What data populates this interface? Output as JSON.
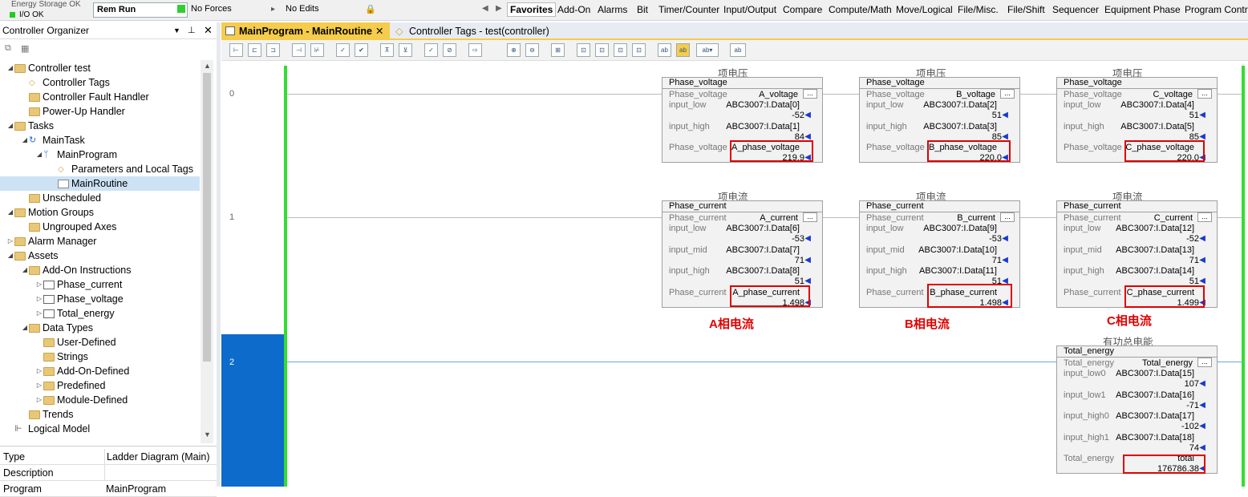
{
  "top": {
    "status1": "Energy Storage OK",
    "status2": "I/O OK",
    "mode": "Rem Run",
    "forces": "No Forces",
    "edits": "No Edits",
    "tabs": [
      "Favorites",
      "Add-On",
      "Alarms",
      "Bit",
      "Timer/Counter",
      "Input/Output",
      "Compare",
      "Compute/Math",
      "Move/Logical",
      "File/Misc.",
      "File/Shift",
      "Sequencer",
      "Equipment Phase",
      "Program Control"
    ]
  },
  "organizer": {
    "title": "Controller Organizer",
    "tree": [
      {
        "label": "Controller test"
      },
      {
        "label": "Controller Tags"
      },
      {
        "label": "Controller Fault Handler"
      },
      {
        "label": "Power-Up Handler"
      },
      {
        "label": "Tasks"
      },
      {
        "label": "MainTask"
      },
      {
        "label": "MainProgram"
      },
      {
        "label": "Parameters and Local Tags"
      },
      {
        "label": "MainRoutine"
      },
      {
        "label": "Unscheduled"
      },
      {
        "label": "Motion Groups"
      },
      {
        "label": "Ungrouped Axes"
      },
      {
        "label": "Alarm Manager"
      },
      {
        "label": "Assets"
      },
      {
        "label": "Add-On Instructions"
      },
      {
        "label": "Phase_current"
      },
      {
        "label": "Phase_voltage"
      },
      {
        "label": "Total_energy"
      },
      {
        "label": "Data Types"
      },
      {
        "label": "User-Defined"
      },
      {
        "label": "Strings"
      },
      {
        "label": "Add-On-Defined"
      },
      {
        "label": "Predefined"
      },
      {
        "label": "Module-Defined"
      },
      {
        "label": "Trends"
      },
      {
        "label": "Logical Model"
      }
    ],
    "props": [
      {
        "k": "Type",
        "v": "Ladder Diagram (Main)"
      },
      {
        "k": "Description",
        "v": ""
      },
      {
        "k": "Program",
        "v": "MainProgram"
      }
    ]
  },
  "editor": {
    "tab1": "MainProgram - MainRoutine",
    "tab2": "Controller Tags - test(controller)",
    "rungs": [
      "0",
      "1",
      "2"
    ],
    "caption_v": "项电压",
    "caption_i": "项电流",
    "caption_e": "有功总电能",
    "red_a": "A相电流",
    "red_b": "B相电流",
    "red_c": "C相电流",
    "blocks": {
      "va": {
        "name": "Phase_voltage",
        "inst": "A_voltage",
        "r1l": "input_low",
        "r1t": "ABC3007:I.Data[0]",
        "r1v": "-52",
        "r2l": "input_high",
        "r2t": "ABC3007:I.Data[1]",
        "r2v": "84",
        "ol": "Phase_voltage",
        "ot": "A_phase_voltage",
        "ov": "219.9"
      },
      "vb": {
        "name": "Phase_voltage",
        "inst": "B_voltage",
        "r1l": "input_low",
        "r1t": "ABC3007:I.Data[2]",
        "r1v": "51",
        "r2l": "input_high",
        "r2t": "ABC3007:I.Data[3]",
        "r2v": "85",
        "ol": "Phase_voltage",
        "ot": "B_phase_voltage",
        "ov": "220.0"
      },
      "vc": {
        "name": "Phase_voltage",
        "inst": "C_voltage",
        "r1l": "input_low",
        "r1t": "ABC3007:I.Data[4]",
        "r1v": "51",
        "r2l": "input_high",
        "r2t": "ABC3007:I.Data[5]",
        "r2v": "85",
        "ol": "Phase_voltage",
        "ot": "C_phase_voltage",
        "ov": "220.0"
      },
      "ia": {
        "name": "Phase_current",
        "inst": "A_current",
        "r1l": "input_low",
        "r1t": "ABC3007:I.Data[6]",
        "r1v": "-53",
        "r2l": "input_mid",
        "r2t": "ABC3007:I.Data[7]",
        "r2v": "71",
        "r3l": "input_high",
        "r3t": "ABC3007:I.Data[8]",
        "r3v": "51",
        "ol": "Phase_current",
        "ot": "A_phase_current",
        "ov": "1.498"
      },
      "ib": {
        "name": "Phase_current",
        "inst": "B_current",
        "r1l": "input_low",
        "r1t": "ABC3007:I.Data[9]",
        "r1v": "-53",
        "r2l": "input_mid",
        "r2t": "ABC3007:I.Data[10]",
        "r2v": "71",
        "r3l": "input_high",
        "r3t": "ABC3007:I.Data[11]",
        "r3v": "51",
        "ol": "Phase_current",
        "ot": "B_phase_current",
        "ov": "1.498"
      },
      "ic": {
        "name": "Phase_current",
        "inst": "C_current",
        "r1l": "input_low",
        "r1t": "ABC3007:I.Data[12]",
        "r1v": "-52",
        "r2l": "input_mid",
        "r2t": "ABC3007:I.Data[13]",
        "r2v": "71",
        "r3l": "input_high",
        "r3t": "ABC3007:I.Data[14]",
        "r3v": "51",
        "ol": "Phase_current",
        "ot": "C_phase_current",
        "ov": "1.499"
      },
      "te": {
        "name": "Total_energy",
        "inst": "Total_energy",
        "r1l": "input_low0",
        "r1t": "ABC3007:I.Data[15]",
        "r1v": "107",
        "r2l": "input_low1",
        "r2t": "ABC3007:I.Data[16]",
        "r2v": "-71",
        "r3l": "input_high0",
        "r3t": "ABC3007:I.Data[17]",
        "r3v": "-102",
        "r4l": "input_high1",
        "r4t": "ABC3007:I.Data[18]",
        "r4v": "74",
        "ol": "Total_energy",
        "ot": "total",
        "ov": "176786.38"
      }
    }
  }
}
